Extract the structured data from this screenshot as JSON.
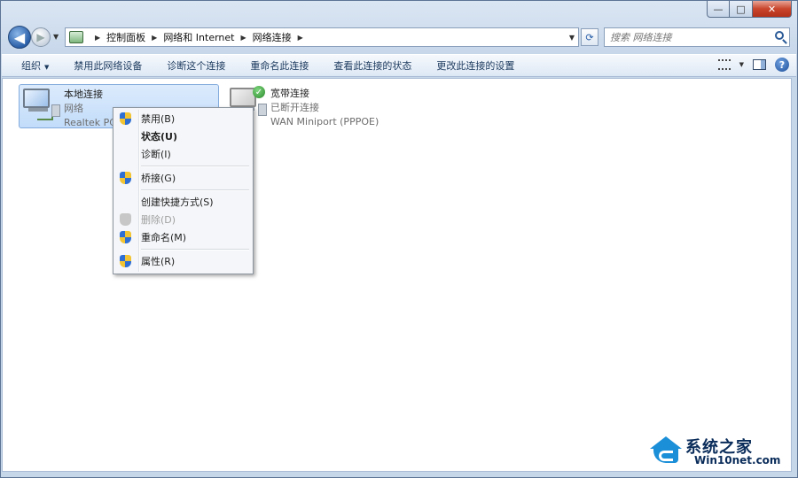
{
  "window": {
    "controls": {
      "minimize": "—",
      "maximize": "□",
      "close": "✕"
    }
  },
  "address_bar": {
    "breadcrumbs": [
      "控制面板",
      "网络和 Internet",
      "网络连接"
    ],
    "search_placeholder": "搜索 网络连接"
  },
  "toolbar": {
    "items": [
      "组织",
      "禁用此网络设备",
      "诊断这个连接",
      "重命名此连接",
      "查看此连接的状态",
      "更改此连接的设置"
    ]
  },
  "connections": [
    {
      "name": "本地连接",
      "status": "网络",
      "adapter": "Realtek PC",
      "selected": true
    },
    {
      "name": "宽带连接",
      "status": "已断开连接",
      "adapter": "WAN Miniport (PPPOE)",
      "selected": false
    }
  ],
  "context_menu": {
    "items": [
      {
        "label": "禁用(B)",
        "shield": true,
        "bold": false,
        "disabled": false
      },
      {
        "label": "状态(U)",
        "shield": false,
        "bold": true,
        "disabled": false
      },
      {
        "label": "诊断(I)",
        "shield": false,
        "bold": false,
        "disabled": false
      },
      {
        "label": "桥接(G)",
        "shield": true,
        "bold": false,
        "disabled": false
      },
      {
        "label": "创建快捷方式(S)",
        "shield": false,
        "bold": false,
        "disabled": false
      },
      {
        "label": "删除(D)",
        "shield": true,
        "bold": false,
        "disabled": true
      },
      {
        "label": "重命名(M)",
        "shield": true,
        "bold": false,
        "disabled": false
      },
      {
        "label": "属性(R)",
        "shield": true,
        "bold": false,
        "disabled": false
      }
    ]
  },
  "watermark": {
    "title": "系统之家",
    "site": "Win10net.com"
  },
  "colors": {
    "accent": "#2a5fa8",
    "selection": "#c2dcfa",
    "close": "#c9452c"
  }
}
